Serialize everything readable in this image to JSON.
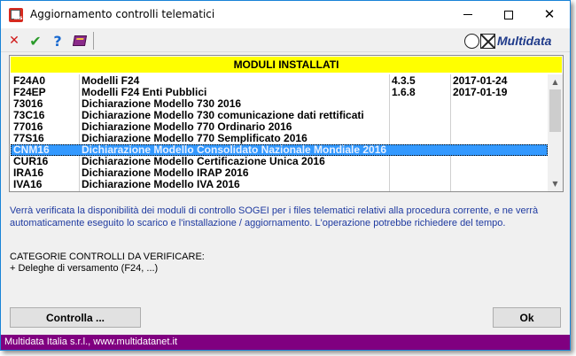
{
  "window": {
    "title": "Aggiornamento controlli telematici"
  },
  "toolbar": {
    "icons": [
      "cancel-icon",
      "confirm-check-icon",
      "help-icon",
      "book-icon"
    ],
    "brand": "Multidata"
  },
  "modules": {
    "header": "MODULI INSTALLATI",
    "rows": [
      {
        "code": "F24A0",
        "description": "Modelli F24",
        "version": "4.3.5",
        "date": "2017-01-24"
      },
      {
        "code": "F24EP",
        "description": "Modelli F24 Enti Pubblici",
        "version": "1.6.8",
        "date": "2017-01-19"
      },
      {
        "code": "73016",
        "description": "Dichiarazione Modello 730 2016",
        "version": "",
        "date": ""
      },
      {
        "code": "73C16",
        "description": "Dichiarazione Modello 730 comunicazione dati rettificati",
        "version": "",
        "date": ""
      },
      {
        "code": "77016",
        "description": "Dichiarazione Modello 770 Ordinario 2016",
        "version": "",
        "date": ""
      },
      {
        "code": "77S16",
        "description": "Dichiarazione Modello 770 Semplificato 2016",
        "version": "",
        "date": ""
      },
      {
        "code": "CNM16",
        "description": "Dichiarazione Modello Consolidato Nazionale Mondiale 2016",
        "version": "",
        "date": ""
      },
      {
        "code": "CUR16",
        "description": "Dichiarazione Modello Certificazione Unica 2016",
        "version": "",
        "date": ""
      },
      {
        "code": "IRA16",
        "description": "Dichiarazione Modello IRAP 2016",
        "version": "",
        "date": ""
      },
      {
        "code": "IVA16",
        "description": "Dichiarazione Modello IVA 2016",
        "version": "",
        "date": ""
      }
    ],
    "selected_index": 6
  },
  "info": {
    "line1": "Verrà verificata la disponibilità dei moduli di controllo SOGEI per i files telematici relativi alla procedura corrente, e ne verrà",
    "line2": "automaticamente eseguito lo scarico e l'installazione / aggiornamento. L'operazione potrebbe richiedere del tempo."
  },
  "categories": {
    "title": "CATEGORIE CONTROLLI DA VERIFICARE:",
    "item": "+ Deleghe di versamento (F24, ...)"
  },
  "buttons": {
    "controlla": "Controlla ...",
    "ok": "Ok"
  },
  "status": {
    "text": "Multidata Italia s.r.l., www.multidatanet.it"
  },
  "colors": {
    "header_bg": "#ffff00",
    "selection_bg": "#3399ff",
    "statusbar_bg": "#800080",
    "info_text": "#1f3aa0"
  }
}
